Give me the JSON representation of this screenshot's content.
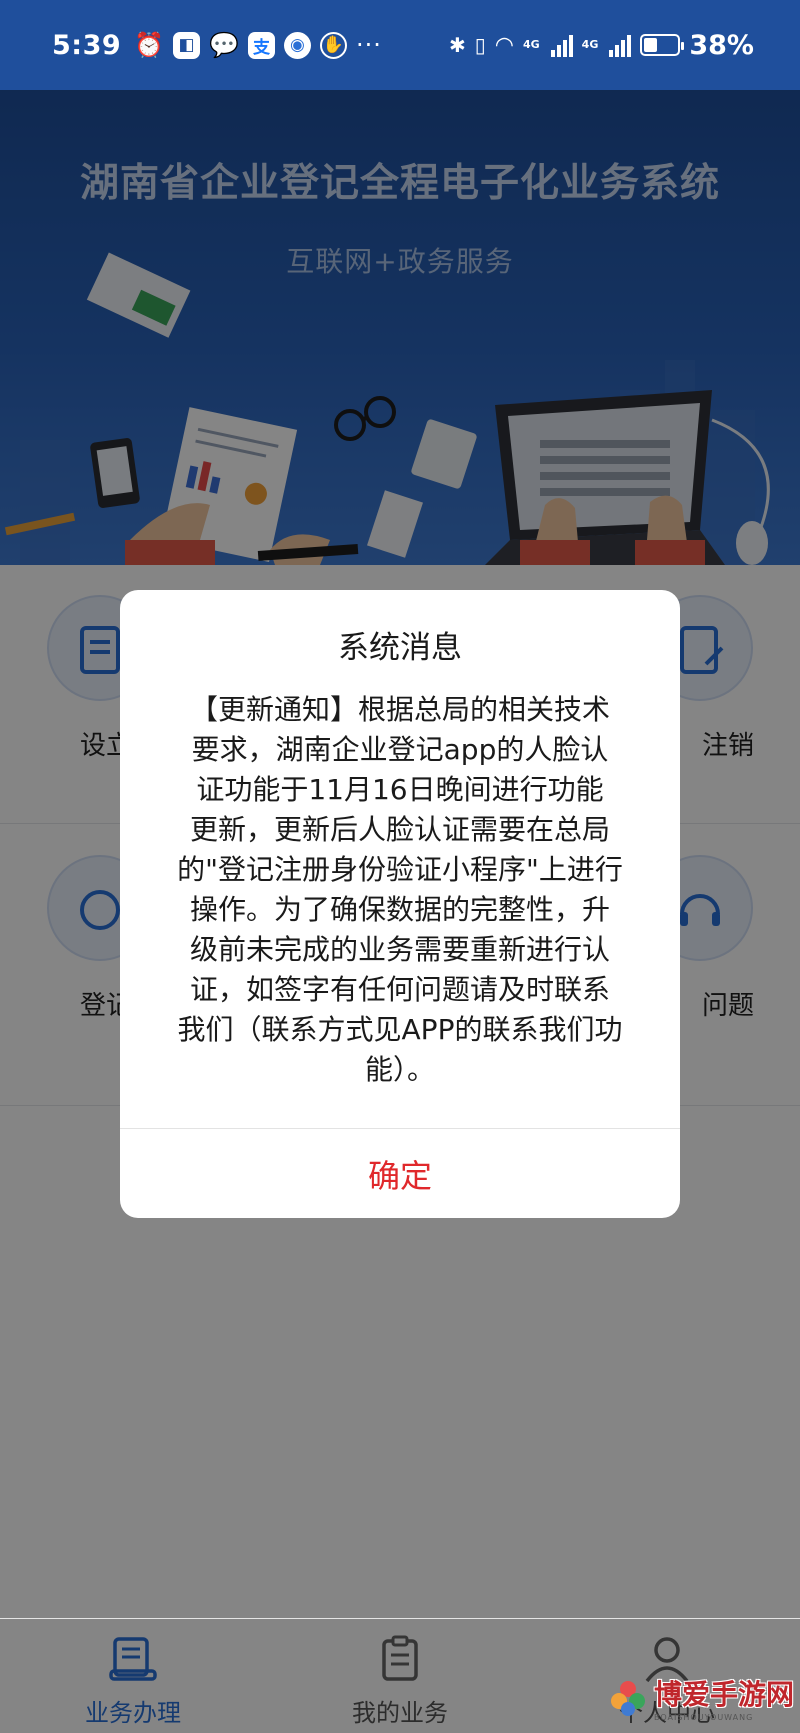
{
  "status_bar": {
    "time": "5:39",
    "battery_percent": "38%",
    "battery_level": 0.38,
    "network_badges": [
      "4G",
      "4G"
    ],
    "app_icons": [
      "alarm-icon",
      "app-badge-icon",
      "wechat-icon",
      "alipay-icon",
      "browser-icon",
      "hand-icon"
    ],
    "more": "···"
  },
  "banner": {
    "title": "湖南省企业登记全程电子化业务系统",
    "subtitle": "互联网+政务服务"
  },
  "grid": {
    "row1": {
      "left_label": "设立",
      "right_label": "注销"
    },
    "row2": {
      "left_label": "登记",
      "right_label": "问题"
    }
  },
  "dialog": {
    "title": "系统消息",
    "lines": [
      "【更新通知】根据总局的相关技术",
      "要求，湖南企业登记app的人脸认",
      "证功能于11月16日晚间进行功能",
      "更新，更新后人脸认证需要在总局",
      "的\"登记注册身份验证小程序\"上进行",
      "操作。为了确保数据的完整性，升",
      "级前未完成的业务需要重新进行认",
      "证，如签字有任何问题请及时联系",
      "我们（联系方式见APP的联系我们功",
      "能）。"
    ],
    "confirm_label": "确定"
  },
  "tabbar": {
    "tabs": [
      {
        "label": "业务办理",
        "icon": "business-handling-icon",
        "active": true
      },
      {
        "label": "我的业务",
        "icon": "my-business-icon",
        "active": false
      },
      {
        "label": "个人中心",
        "icon": "personal-center-icon",
        "active": false
      }
    ]
  },
  "watermark": {
    "text": "博爱手游网",
    "sub": "BOAISHOUYOUWANG"
  },
  "colors": {
    "banner_blue": "#1f4f9c",
    "accent_blue": "#2a6fd6",
    "confirm_red": "#e0282b"
  }
}
